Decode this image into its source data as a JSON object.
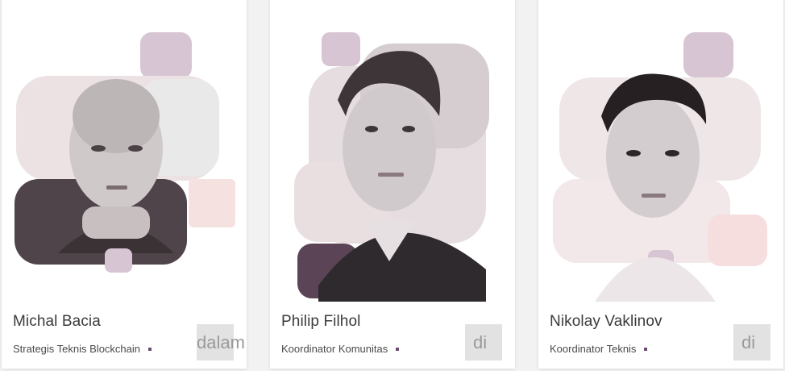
{
  "team": [
    {
      "name": "Michal Bacia",
      "role": "Strategis Teknis Blockchain",
      "button_label": "dalam",
      "photo_icon": "portrait-bald-man"
    },
    {
      "name": "Philip Filhol",
      "role": "Koordinator Komunitas",
      "button_label": "di",
      "photo_icon": "portrait-young-man"
    },
    {
      "name": "Nikolay Vaklinov",
      "role": "Koordinator Teknis",
      "button_label": "di",
      "photo_icon": "portrait-dark-hair-man"
    }
  ],
  "colors": {
    "accent_dot": "#6c4c73",
    "shape_lilac": "#d8c5d4",
    "shape_pink": "#f5dfe0",
    "shape_plum": "#5a4456"
  }
}
